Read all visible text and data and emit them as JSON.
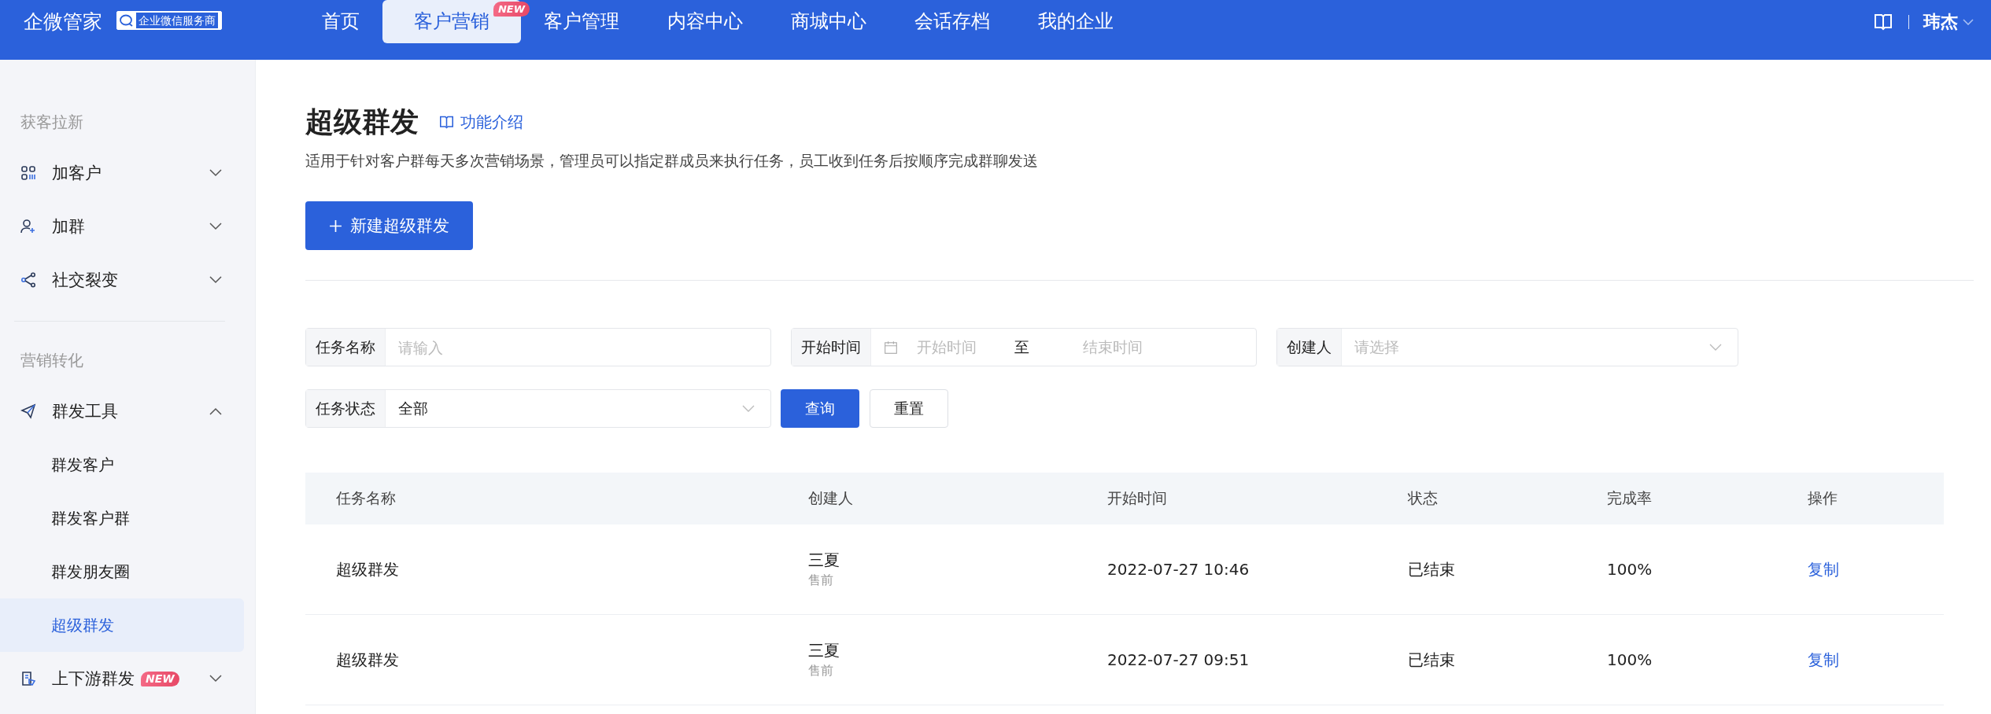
{
  "header": {
    "logo": "企微管家",
    "badge": "企业微信服务商",
    "nav": [
      {
        "label": "首页",
        "selected": false
      },
      {
        "label": "客户营销",
        "selected": true,
        "tag": "NEW"
      },
      {
        "label": "客户管理",
        "selected": false
      },
      {
        "label": "内容中心",
        "selected": false
      },
      {
        "label": "商城中心",
        "selected": false
      },
      {
        "label": "会话存档",
        "selected": false
      },
      {
        "label": "我的企业",
        "selected": false
      }
    ],
    "user": "玮杰"
  },
  "sidebar": {
    "sections": [
      {
        "title": "获客拉新",
        "items": [
          {
            "label": "加客户",
            "expanded": false
          },
          {
            "label": "加群",
            "expanded": false
          },
          {
            "label": "社交裂变",
            "expanded": false
          }
        ]
      },
      {
        "title": "营销转化",
        "items": [
          {
            "label": "群发工具",
            "expanded": true,
            "children": [
              {
                "label": "群发客户",
                "selected": false
              },
              {
                "label": "群发客户群",
                "selected": false
              },
              {
                "label": "群发朋友圈",
                "selected": false
              },
              {
                "label": "超级群发",
                "selected": true
              }
            ]
          },
          {
            "label": "上下游群发",
            "expanded": false,
            "tag": "NEW"
          }
        ]
      }
    ]
  },
  "page": {
    "title": "超级群发",
    "intro_link": "功能介绍",
    "description": "适用于针对客户群每天多次营销场景，管理员可以指定群成员来执行任务，员工收到任务后按顺序完成群聊发送",
    "create_button": "新建超级群发"
  },
  "filters": [
    {
      "kind": "text",
      "label": "任务名称",
      "placeholder": "请输入"
    },
    {
      "kind": "daterange",
      "label": "开始时间",
      "start_placeholder": "开始时间",
      "separator": "至",
      "end_placeholder": "结束时间"
    },
    {
      "kind": "select",
      "label": "创建人",
      "placeholder": "请选择"
    },
    {
      "kind": "select",
      "label": "任务状态",
      "value": "全部"
    }
  ],
  "filter_buttons": [
    "查询",
    "重置"
  ],
  "table": {
    "columns": [
      "任务名称",
      "创建人",
      "开始时间",
      "状态",
      "完成率",
      "操作"
    ],
    "rows": [
      {
        "name": "超级群发",
        "creator": "三夏",
        "department": "售前",
        "start": "2022-07-27 10:46",
        "status": "已结束",
        "rate": "100%",
        "action": "复制"
      },
      {
        "name": "超级群发",
        "creator": "三夏",
        "department": "售前",
        "start": "2022-07-27 09:51",
        "status": "已结束",
        "rate": "100%",
        "action": "复制"
      }
    ]
  }
}
